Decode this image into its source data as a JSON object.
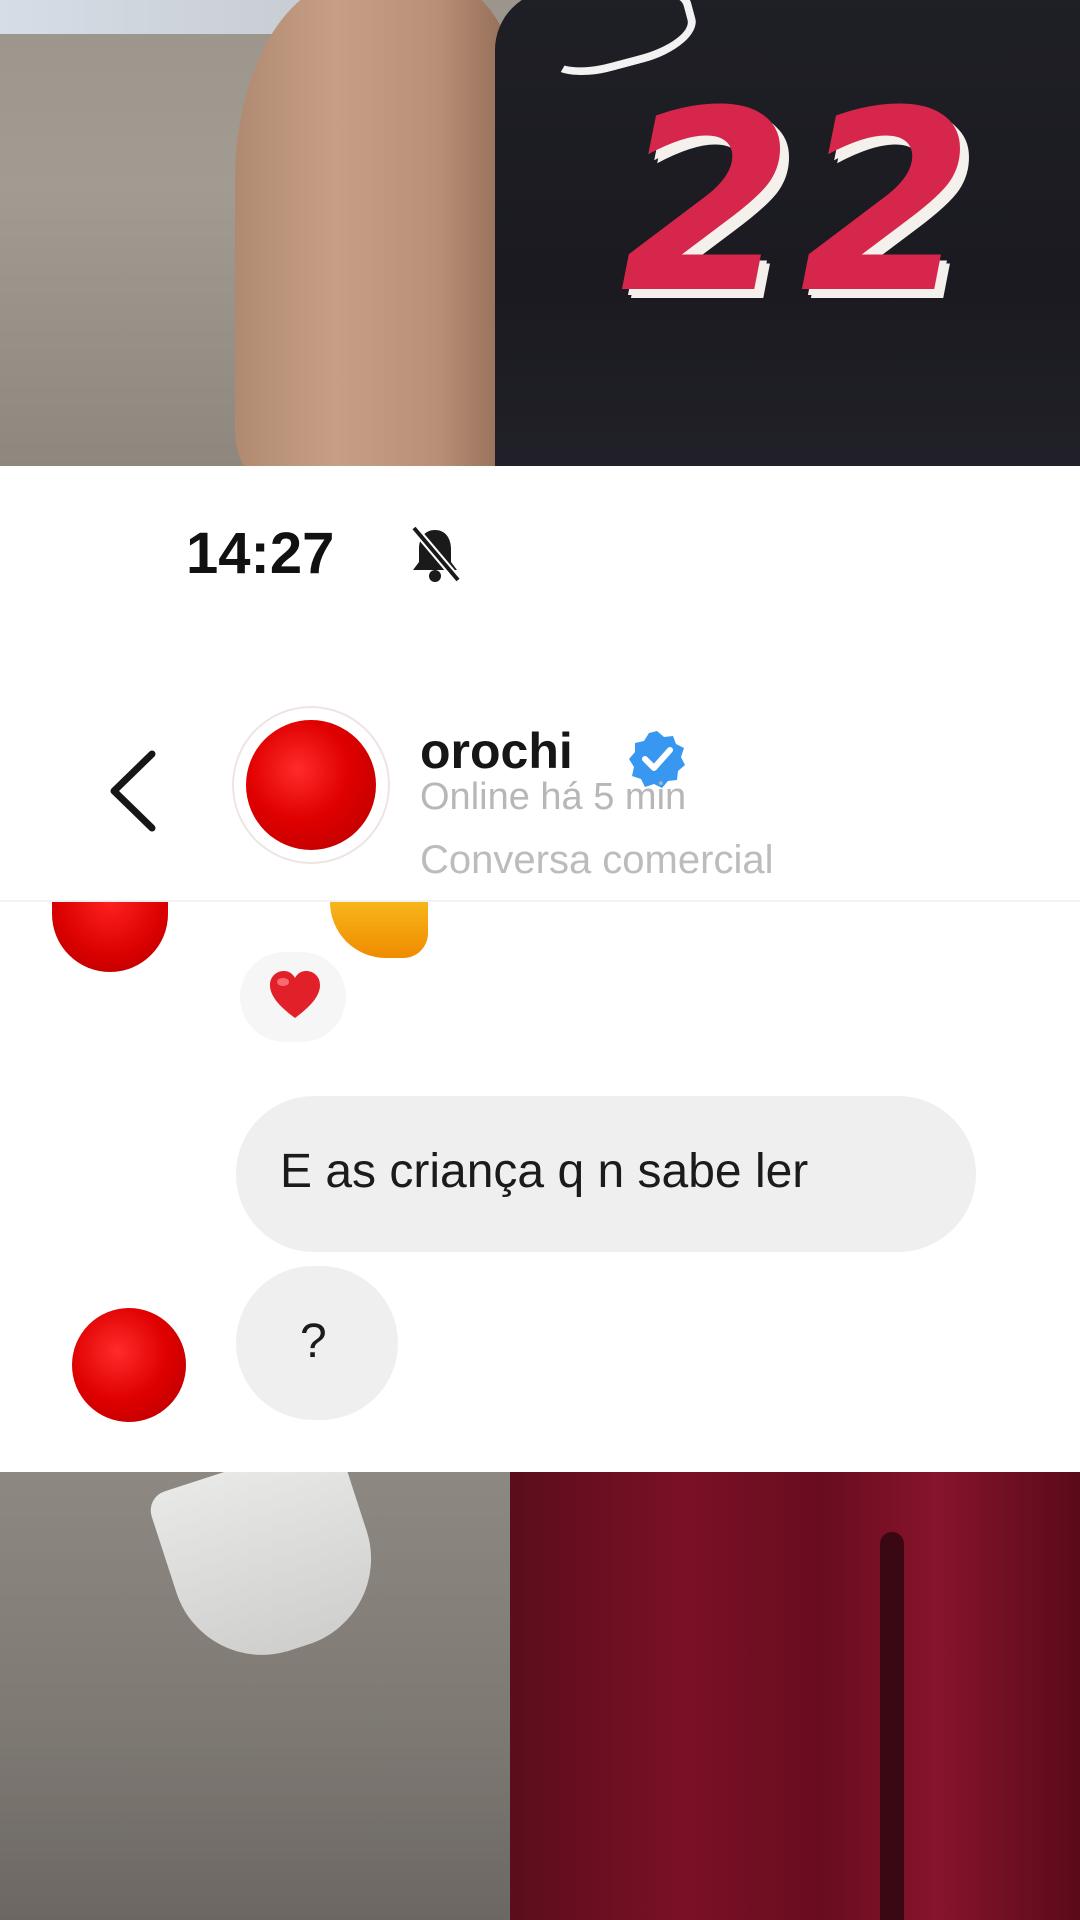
{
  "status_bar": {
    "time": "14:27",
    "icons": [
      "bell-muted-icon"
    ]
  },
  "chat_header": {
    "contact_name": "orochi",
    "verified": true,
    "online_status": "Online há 5 min",
    "conversation_type": "Conversa comercial",
    "icons": [
      "back-chevron-icon",
      "verified-badge-icon"
    ]
  },
  "messages": [
    {
      "text": "E as criança q n sabe ler"
    },
    {
      "text": "?"
    }
  ],
  "reaction": {
    "icon": "red-heart-icon"
  },
  "background": {
    "jersey_number": "22"
  },
  "colors": {
    "avatar_red": "#e00000",
    "verified_blue": "#3897f0",
    "bubble_gray": "#efefef",
    "jersey_red": "#d6264b"
  }
}
